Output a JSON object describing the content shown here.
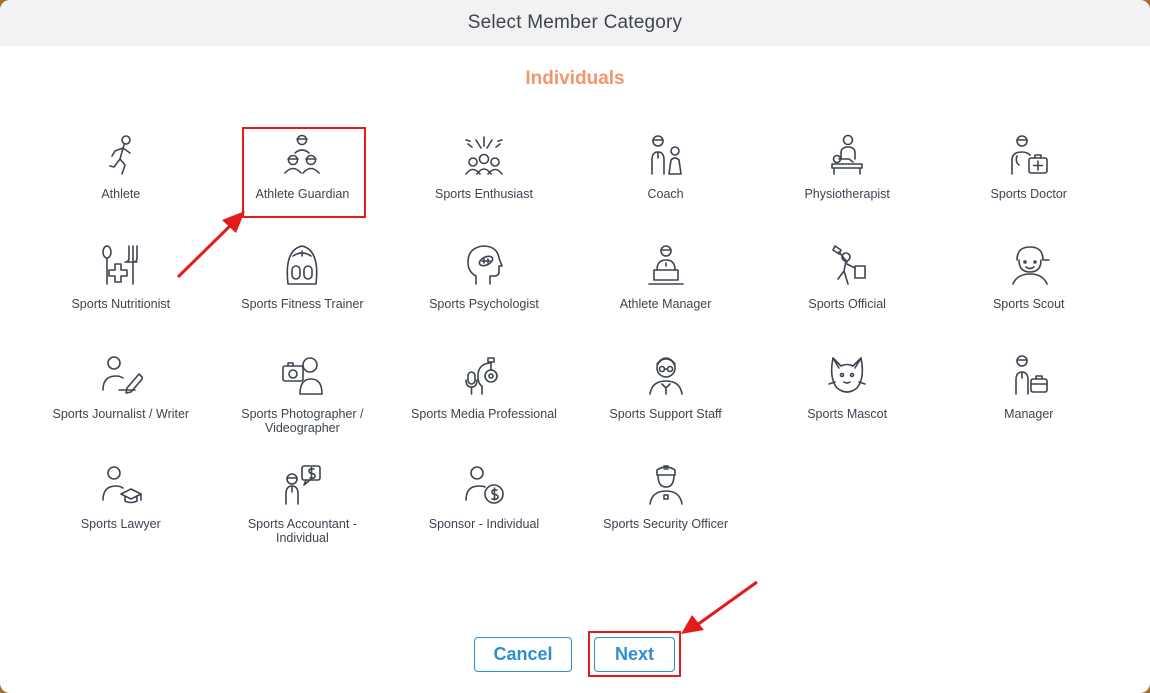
{
  "dialog": {
    "title": "Select Member Category",
    "section_title": "Individuals"
  },
  "categories": [
    {
      "label": "Athlete",
      "icon": "athlete-icon"
    },
    {
      "label": "Athlete Guardian",
      "icon": "athlete-guardian-icon"
    },
    {
      "label": "Sports Enthusiast",
      "icon": "sports-enthusiast-icon"
    },
    {
      "label": "Coach",
      "icon": "coach-icon"
    },
    {
      "label": "Physiotherapist",
      "icon": "physiotherapist-icon"
    },
    {
      "label": "Sports Doctor",
      "icon": "sports-doctor-icon"
    },
    {
      "label": "Sports Nutritionist",
      "icon": "sports-nutritionist-icon"
    },
    {
      "label": "Sports Fitness Trainer",
      "icon": "sports-fitness-trainer-icon"
    },
    {
      "label": "Sports Psychologist",
      "icon": "sports-psychologist-icon"
    },
    {
      "label": "Athlete Manager",
      "icon": "athlete-manager-icon"
    },
    {
      "label": "Sports Official",
      "icon": "sports-official-icon"
    },
    {
      "label": "Sports Scout",
      "icon": "sports-scout-icon"
    },
    {
      "label": "Sports Journalist / Writer",
      "icon": "sports-journalist-icon"
    },
    {
      "label": "Sports Photographer / Videographer",
      "icon": "sports-photographer-icon"
    },
    {
      "label": "Sports Media Professional",
      "icon": "sports-media-icon"
    },
    {
      "label": "Sports Support Staff",
      "icon": "sports-support-staff-icon"
    },
    {
      "label": "Sports Mascot",
      "icon": "sports-mascot-icon"
    },
    {
      "label": "Manager",
      "icon": "manager-icon"
    },
    {
      "label": "Sports Lawyer",
      "icon": "sports-lawyer-icon"
    },
    {
      "label": "Sports Accountant - Individual",
      "icon": "sports-accountant-icon"
    },
    {
      "label": "Sponsor - Individual",
      "icon": "sponsor-icon"
    },
    {
      "label": "Sports Security Officer",
      "icon": "sports-security-officer-icon"
    }
  ],
  "highlighted_category": "Athlete Guardian",
  "buttons": {
    "cancel_label": "Cancel",
    "next_label": "Next"
  },
  "colors": {
    "accent": "#2d8fd0",
    "section_title": "#f5956b",
    "annotation": "#e31b1b",
    "text": "#3d4450",
    "header_bg": "#f2f2f2"
  }
}
